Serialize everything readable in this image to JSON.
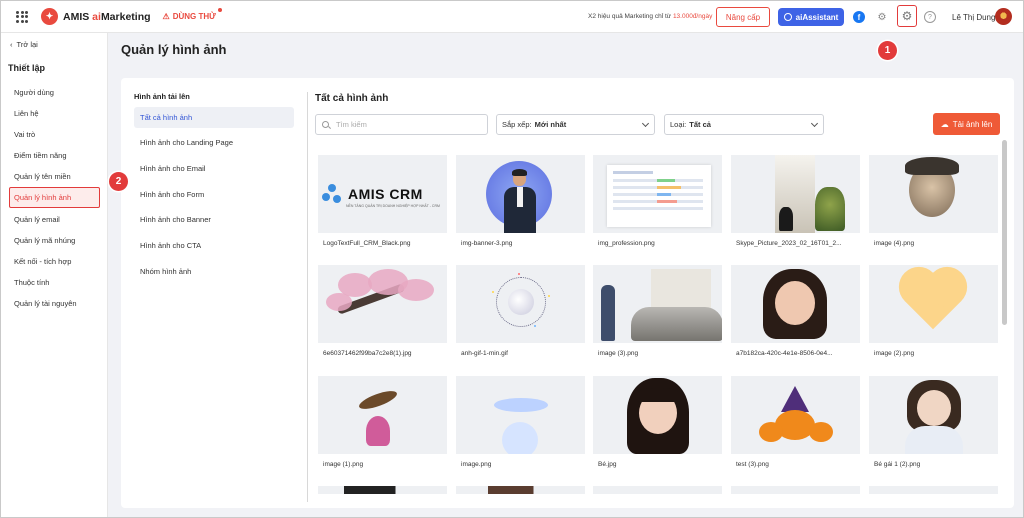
{
  "topbar": {
    "brand_name": "AMIS ",
    "brand_ai": "ai",
    "brand_suffix": "Marketing",
    "trial_label": "DÙNG THỬ",
    "promo_text": "X2 hiệu quả Marketing chỉ từ ",
    "promo_price": "13.000đ/ngày",
    "upgrade_label": "Nâng cấp",
    "ai_assistant_label": "aiAssistant",
    "user_name": "Lê Thị Dung",
    "accent_color": "#e94a3f",
    "ai_button_color": "#3e63e6"
  },
  "sidebar": {
    "back_label": "Trở lại",
    "section_title": "Thiết lập",
    "items": [
      {
        "label": "Người dùng"
      },
      {
        "label": "Liên hệ"
      },
      {
        "label": "Vai trò"
      },
      {
        "label": "Điểm tiềm năng"
      },
      {
        "label": "Quản lý tên miền"
      },
      {
        "label": "Quản lý hình ảnh",
        "active": true
      },
      {
        "label": "Quản lý email"
      },
      {
        "label": "Quản lý mã nhúng"
      },
      {
        "label": "Kết nối - tích hợp"
      },
      {
        "label": "Thuộc tính"
      },
      {
        "label": "Quản lý tài nguyên"
      }
    ]
  },
  "callouts": [
    "1",
    "2"
  ],
  "page": {
    "title": "Quản lý hình ảnh"
  },
  "categories": {
    "title": "Hình ảnh tải lên",
    "items": [
      {
        "label": "Tất cả hình ảnh",
        "active": true
      },
      {
        "label": "Hình ảnh cho Landing Page"
      },
      {
        "label": "Hình ảnh cho Email"
      },
      {
        "label": "Hình ảnh cho Form"
      },
      {
        "label": "Hình ảnh cho Banner"
      },
      {
        "label": "Hình ảnh cho CTA"
      },
      {
        "label": "Nhóm hình ảnh"
      }
    ]
  },
  "gallery": {
    "title": "Tất cả hình ảnh",
    "search_placeholder": "Tìm kiếm",
    "sort_label": "Sắp xếp:",
    "sort_value": "Mới nhất",
    "type_label": "Loại:",
    "type_value": "Tất cả",
    "upload_label": "Tải ảnh lên",
    "crm_logo_text": "AMIS CRM",
    "crm_logo_sub": "NỀN TẢNG QUẢN TRỊ DOANH NGHIỆP HỢP NHẤT - CRM",
    "images": [
      {
        "name": "LogoTextFull_CRM_Black.png",
        "thumb": "crm"
      },
      {
        "name": "img-banner-3.png",
        "thumb": "banner"
      },
      {
        "name": "img_profession.png",
        "thumb": "profession"
      },
      {
        "name": "Skype_Picture_2023_02_16T01_2...",
        "thumb": "window"
      },
      {
        "name": "image (4).png",
        "thumb": "boy"
      },
      {
        "name": "6e60371462f99ba7c2e8(1).jpg",
        "thumb": "blossom"
      },
      {
        "name": "anh-gif-1-min.gif",
        "thumb": "moon"
      },
      {
        "name": "image (3).png",
        "thumb": "garage"
      },
      {
        "name": "a7b182ca-420c-4e1e-8506-0e4...",
        "thumb": "girl1"
      },
      {
        "name": "image (2).png",
        "thumb": "heart"
      },
      {
        "name": "image (1).png",
        "thumb": "forest"
      },
      {
        "name": "image.png",
        "thumb": "whale"
      },
      {
        "name": "Bé.jpg",
        "thumb": "girl2"
      },
      {
        "name": "test (3).png",
        "thumb": "pumpkin"
      },
      {
        "name": "Bé gái 1 (2).png",
        "thumb": "girl3"
      }
    ]
  }
}
